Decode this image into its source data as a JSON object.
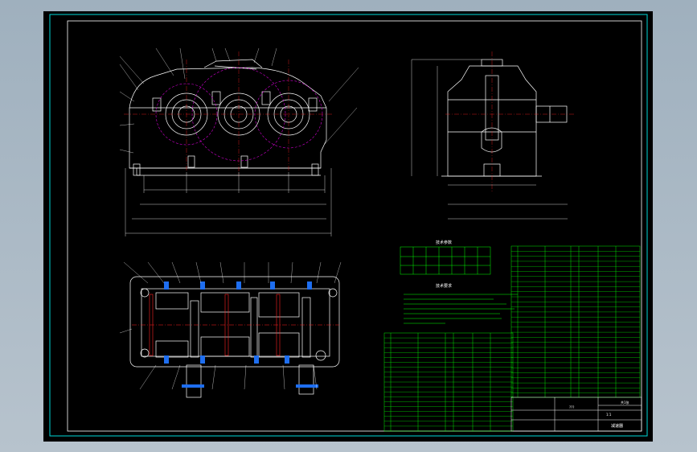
{
  "viewport": {
    "background": "#000000",
    "frame_color": "#00d7d7",
    "geometry_color": "#ffffff",
    "centerline_color": "#ff2020",
    "gear_color": "#d000d0",
    "hatch_color": "#1e6ef0",
    "table_color": "#00ff00"
  },
  "drawing": {
    "tech_params_title": "技术参数",
    "tech_req_title": "技术要求",
    "title_block_name": "减速器",
    "title_block_code": "???",
    "title_block_scale": "1:1",
    "title_block_sheet": "共1张"
  }
}
